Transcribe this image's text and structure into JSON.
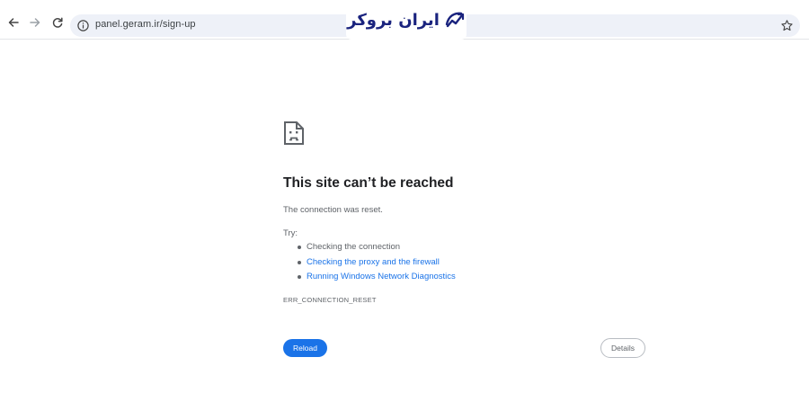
{
  "browser": {
    "url": "panel.geram.ir/sign-up"
  },
  "watermark": {
    "brand_text": "ایران بروکر",
    "brand_color": "#1a237e"
  },
  "icons": {
    "back": "arrow-left-icon",
    "forward": "arrow-right-icon",
    "reload": "reload-icon",
    "site_info": "info-icon",
    "bookmark": "star-icon",
    "error": "sad-page-icon"
  },
  "error_page": {
    "title": "This site can’t be reached",
    "subtitle": "The connection was reset.",
    "try_label": "Try:",
    "suggestions": [
      {
        "text": "Checking the connection",
        "link": false
      },
      {
        "text": "Checking the proxy and the firewall",
        "link": true
      },
      {
        "text": "Running Windows Network Diagnostics",
        "link": true
      }
    ],
    "error_code": "ERR_CONNECTION_RESET",
    "reload_label": "Reload",
    "details_label": "Details"
  },
  "colors": {
    "accent": "#1a73e8",
    "muted_text": "#5f6368",
    "heading": "#202124"
  }
}
